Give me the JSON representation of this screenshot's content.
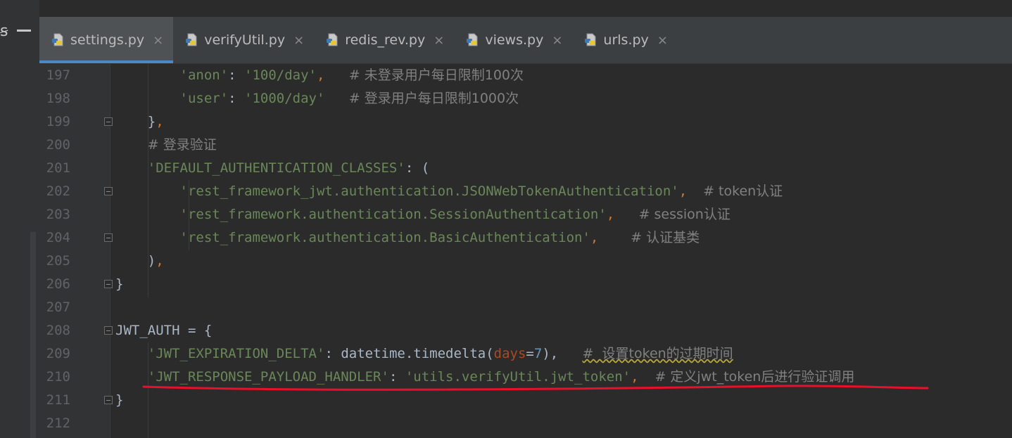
{
  "tabs": [
    {
      "label": "settings.py",
      "active": true
    },
    {
      "label": "verifyUtil.py",
      "active": false
    },
    {
      "label": "redis_rev.py",
      "active": false
    },
    {
      "label": "views.py",
      "active": false
    },
    {
      "label": "urls.py",
      "active": false
    }
  ],
  "toolbar": {
    "close_glyph": "×",
    "minimize_icon": "minimize-icon"
  },
  "editor": {
    "lines": [
      {
        "num": "197",
        "indent": "        ",
        "parts": [
          {
            "t": "'anon'",
            "c": "str"
          },
          {
            "t": ": ",
            "c": "plain"
          },
          {
            "t": "'100/day'",
            "c": "str"
          },
          {
            "t": ",",
            "c": "punc"
          },
          {
            "t": "   ",
            "c": "plain"
          },
          {
            "t": "# 未登录用户每日限制100次",
            "c": "cmt"
          }
        ]
      },
      {
        "num": "198",
        "indent": "        ",
        "parts": [
          {
            "t": "'user'",
            "c": "str"
          },
          {
            "t": ": ",
            "c": "plain"
          },
          {
            "t": "'1000/day'",
            "c": "str"
          },
          {
            "t": "   ",
            "c": "plain"
          },
          {
            "t": "# 登录用户每日限制1000次",
            "c": "cmt"
          }
        ]
      },
      {
        "num": "199",
        "indent": "    ",
        "fold": true,
        "parts": [
          {
            "t": "}",
            "c": "plain"
          },
          {
            "t": ",",
            "c": "punc"
          }
        ]
      },
      {
        "num": "200",
        "indent": "    ",
        "parts": [
          {
            "t": "# 登录验证",
            "c": "cmt"
          }
        ]
      },
      {
        "num": "201",
        "indent": "    ",
        "parts": [
          {
            "t": "'DEFAULT_AUTHENTICATION_CLASSES'",
            "c": "str"
          },
          {
            "t": ": (",
            "c": "plain"
          }
        ]
      },
      {
        "num": "202",
        "indent": "        ",
        "fold": true,
        "parts": [
          {
            "t": "'rest_framework_jwt.authentication.JSONWebTokenAuthentication'",
            "c": "str"
          },
          {
            "t": ",",
            "c": "punc"
          },
          {
            "t": "  ",
            "c": "plain"
          },
          {
            "t": "# token认证",
            "c": "cmt"
          }
        ]
      },
      {
        "num": "203",
        "indent": "        ",
        "parts": [
          {
            "t": "'rest_framework.authentication.SessionAuthentication'",
            "c": "str"
          },
          {
            "t": ",",
            "c": "punc"
          },
          {
            "t": "   ",
            "c": "plain"
          },
          {
            "t": "# session认证",
            "c": "cmt"
          }
        ]
      },
      {
        "num": "204",
        "indent": "        ",
        "fold": true,
        "parts": [
          {
            "t": "'rest_framework.authentication.BasicAuthentication'",
            "c": "str"
          },
          {
            "t": ",",
            "c": "punc"
          },
          {
            "t": "    ",
            "c": "plain"
          },
          {
            "t": "# 认证基类",
            "c": "cmt"
          }
        ]
      },
      {
        "num": "205",
        "indent": "    ",
        "parts": [
          {
            "t": ")",
            "c": "plain"
          },
          {
            "t": ",",
            "c": "punc"
          }
        ]
      },
      {
        "num": "206",
        "indent": "",
        "fold": true,
        "parts": [
          {
            "t": "}",
            "c": "plain"
          }
        ]
      },
      {
        "num": "207",
        "indent": "",
        "parts": []
      },
      {
        "num": "208",
        "indent": "",
        "fold": true,
        "parts": [
          {
            "t": "JWT_AUTH = {",
            "c": "plain"
          }
        ]
      },
      {
        "num": "209",
        "indent": "    ",
        "parts": [
          {
            "t": "'JWT_EXPIRATION_DELTA'",
            "c": "str"
          },
          {
            "t": ": datetime.timedelta(",
            "c": "plain"
          },
          {
            "t": "days",
            "c": "kw"
          },
          {
            "t": "=",
            "c": "plain"
          },
          {
            "t": "7",
            "c": "num"
          },
          {
            "t": "),",
            "c": "plain"
          },
          {
            "t": "   ",
            "c": "plain"
          },
          {
            "t": "#  设置token的过期时间",
            "c": "cmt",
            "squiggle": true
          }
        ]
      },
      {
        "num": "210",
        "indent": "    ",
        "parts": [
          {
            "t": "'JWT_RESPONSE_PAYLOAD_HANDLER'",
            "c": "str"
          },
          {
            "t": ": ",
            "c": "plain"
          },
          {
            "t": "'utils.verifyUtil.jwt_token'",
            "c": "str"
          },
          {
            "t": ",",
            "c": "punc"
          },
          {
            "t": "  ",
            "c": "plain"
          },
          {
            "t": "# 定义jwt_token后进行验证调用",
            "c": "cmt"
          }
        ]
      },
      {
        "num": "211",
        "indent": "",
        "fold": true,
        "parts": [
          {
            "t": "}",
            "c": "plain"
          }
        ]
      },
      {
        "num": "212",
        "indent": "",
        "parts": []
      }
    ]
  },
  "colors": {
    "background": "#2b2b2b",
    "string": "#6a8759",
    "comment": "#808080",
    "keyword_arg": "#aa4926",
    "number": "#6897bb",
    "annotation_underline": "#e8102a"
  }
}
